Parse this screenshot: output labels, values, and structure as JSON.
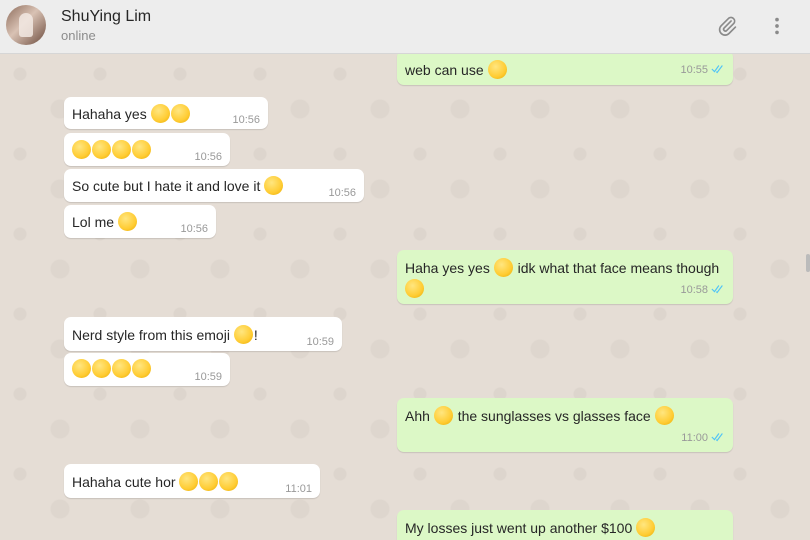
{
  "header": {
    "contact_name": "ShuYing Lim",
    "status": "online",
    "attach_icon": "paperclip-icon",
    "menu_icon": "more-vertical-icon"
  },
  "colors": {
    "incoming": "#ffffff",
    "outgoing": "#dcf8c6",
    "read_ticks": "#4fc3f7",
    "background": "#e5ddd5"
  },
  "messages": [
    {
      "id": "m0",
      "dir": "out",
      "text": "web can use",
      "emoji_after": [
        "joy"
      ],
      "time": "10:55",
      "read": true
    },
    {
      "id": "m1",
      "dir": "in",
      "text": "Hahaha yes",
      "emoji_after": [
        "cry",
        "cry"
      ],
      "time": "10:56"
    },
    {
      "id": "m2",
      "dir": "in",
      "text": "",
      "emoji_after": [
        "nerd",
        "nerd",
        "nerd",
        "nerd"
      ],
      "time": "10:56"
    },
    {
      "id": "m3",
      "dir": "in",
      "text": "So cute but I hate it and love it",
      "emoji_after": [
        "joy"
      ],
      "time": "10:56"
    },
    {
      "id": "m4",
      "dir": "in",
      "text": "Lol me",
      "emoji_after": [
        "joy"
      ],
      "time": "10:56"
    },
    {
      "id": "m5",
      "dir": "out",
      "text": "Haha yes yes",
      "emoji_after": [
        "joy"
      ],
      "text2": "idk what that face means though",
      "emoji_line2": [
        "joy"
      ],
      "time": "10:58",
      "read": true
    },
    {
      "id": "m6",
      "dir": "in",
      "text": "Nerd style from this emoji",
      "emoji_after": [
        "sunglasses"
      ],
      "text2": "!",
      "time": "10:59"
    },
    {
      "id": "m7",
      "dir": "in",
      "text": "",
      "emoji_after": [
        "joy",
        "joy",
        "joy",
        "joy"
      ],
      "time": "10:59"
    },
    {
      "id": "m8",
      "dir": "out",
      "text": "Ahh",
      "emoji_after": [
        "joy"
      ],
      "text2": "the sunglasses vs glasses face",
      "emoji_end": [
        "joy"
      ],
      "time": "11:00",
      "read": true
    },
    {
      "id": "m9",
      "dir": "in",
      "text": "Hahaha cute hor",
      "emoji_after": [
        "relieved",
        "relieved",
        "relieved"
      ],
      "time": "11:01"
    },
    {
      "id": "m10",
      "dir": "out",
      "text": "My losses just went up another $100",
      "emoji_after": [
        "hushed"
      ],
      "time": "",
      "read": false
    }
  ]
}
